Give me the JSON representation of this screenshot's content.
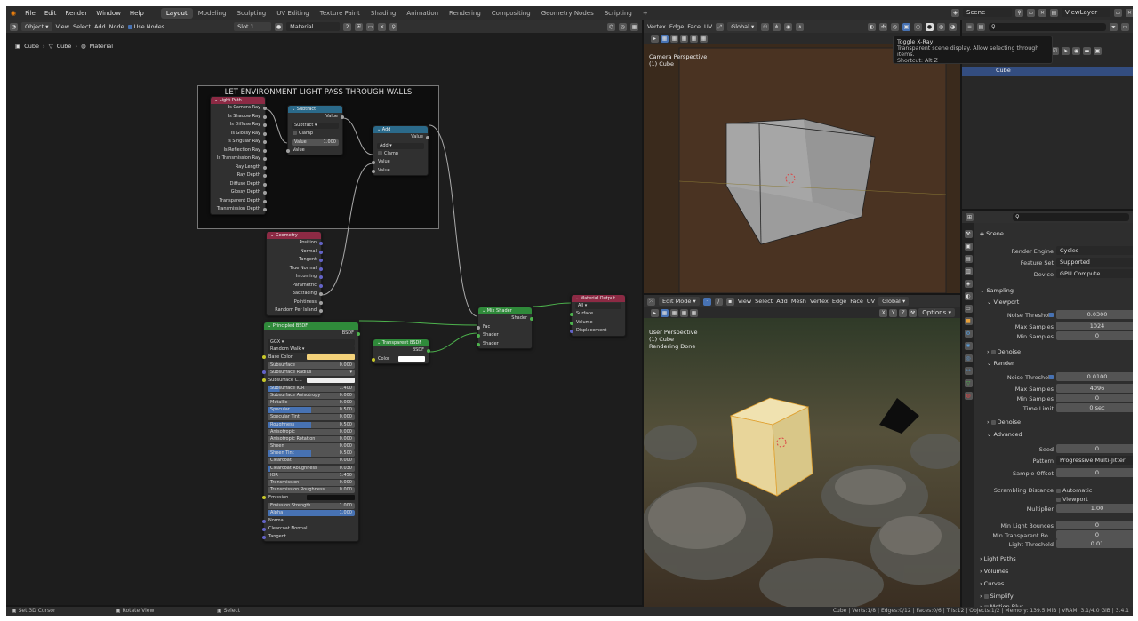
{
  "menu": [
    "File",
    "Edit",
    "Render",
    "Window",
    "Help"
  ],
  "workspaces": [
    "Layout",
    "Modeling",
    "Sculpting",
    "UV Editing",
    "Texture Paint",
    "Shading",
    "Animation",
    "Rendering",
    "Compositing",
    "Geometry Nodes",
    "Scripting"
  ],
  "active_workspace": "Layout",
  "scene_name": "Scene",
  "view_layer": "ViewLayer",
  "node_editor": {
    "header": {
      "mode": "Object",
      "menus": [
        "View",
        "Select",
        "Add",
        "Node"
      ],
      "use_nodes": "Use Nodes",
      "slot": "Slot 1",
      "material": "Material",
      "material_users": "2"
    },
    "breadcrumb": [
      "Cube",
      "Cube",
      "Material"
    ],
    "frame_label": "LET ENVIRONMENT LIGHT PASS THROUGH WALLS",
    "light_path": {
      "title": "Light Path",
      "outputs": [
        "Is Camera Ray",
        "Is Shadow Ray",
        "Is Diffuse Ray",
        "Is Glossy Ray",
        "Is Singular Ray",
        "Is Reflection Ray",
        "Is Transmission Ray",
        "Ray Length",
        "Ray Depth",
        "Diffuse Depth",
        "Glossy Depth",
        "Transparent Depth",
        "Transmission Depth"
      ]
    },
    "subtract": {
      "title": "Subtract",
      "out": "Value",
      "op": "Subtract",
      "clamp": "Clamp",
      "value_label": "Value",
      "value": "1.000",
      "in": "Value"
    },
    "add": {
      "title": "Add",
      "out": "Value",
      "op": "Add",
      "clamp": "Clamp",
      "in1": "Value",
      "in2": "Value"
    },
    "geometry": {
      "title": "Geometry",
      "outputs": [
        "Position",
        "Normal",
        "Tangent",
        "True Normal",
        "Incoming",
        "Parametric",
        "Backfacing",
        "Pointiness",
        "Random Per Island"
      ]
    },
    "bsdf": {
      "title": "Principled BSDF",
      "out": "BSDF",
      "dist": "GGX",
      "sss": "Random Walk",
      "fields": [
        {
          "label": "Base Color",
          "value": "",
          "kind": "color",
          "color": "#f4d27a"
        },
        {
          "label": "Subsurface",
          "value": "0.000",
          "fill": "0%"
        },
        {
          "label": "Subsurface Radius",
          "value": "",
          "kind": "dd"
        },
        {
          "label": "Subsurface C...",
          "value": "",
          "kind": "color",
          "color": "#eeeeee"
        },
        {
          "label": "Subsurface IOR",
          "value": "1.400",
          "fill": "14%"
        },
        {
          "label": "Subsurface Anisotropy",
          "value": "0.000",
          "fill": "0%"
        },
        {
          "label": "Metallic",
          "value": "0.000",
          "fill": "0%"
        },
        {
          "label": "Specular",
          "value": "0.500",
          "fill": "50%"
        },
        {
          "label": "Specular Tint",
          "value": "0.000",
          "fill": "0%"
        },
        {
          "label": "Roughness",
          "value": "0.500",
          "fill": "50%"
        },
        {
          "label": "Anisotropic",
          "value": "0.000",
          "fill": "0%"
        },
        {
          "label": "Anisotropic Rotation",
          "value": "0.000",
          "fill": "0%"
        },
        {
          "label": "Sheen",
          "value": "0.000",
          "fill": "0%"
        },
        {
          "label": "Sheen Tint",
          "value": "0.500",
          "fill": "50%"
        },
        {
          "label": "Clearcoat",
          "value": "0.000",
          "fill": "0%"
        },
        {
          "label": "Clearcoat Roughness",
          "value": "0.030",
          "fill": "3%"
        },
        {
          "label": "IOR",
          "value": "1.450",
          "fill": "0%"
        },
        {
          "label": "Transmission",
          "value": "0.000",
          "fill": "0%"
        },
        {
          "label": "Transmission Roughness",
          "value": "0.000",
          "fill": "0%"
        },
        {
          "label": "Emission",
          "value": "",
          "kind": "color",
          "color": "#111111"
        },
        {
          "label": "Emission Strength",
          "value": "1.000",
          "fill": "0%"
        },
        {
          "label": "Alpha",
          "value": "1.000",
          "fill": "100%"
        }
      ],
      "inputs": [
        "Normal",
        "Clearcoat Normal",
        "Tangent"
      ]
    },
    "transparent": {
      "title": "Transparent BSDF",
      "out": "BSDF",
      "color_label": "Color"
    },
    "mix": {
      "title": "Mix Shader",
      "out": "Shader",
      "in": [
        "Fac",
        "Shader",
        "Shader"
      ]
    },
    "output": {
      "title": "Material Output",
      "target": "All",
      "in": [
        "Surface",
        "Volume",
        "Displacement"
      ]
    }
  },
  "tooltip": {
    "title": "Toggle X-Ray",
    "desc": "Transparent scene display. Allow selecting through items.",
    "shortcut": "Shortcut: Alt Z"
  },
  "top_view": {
    "menus": [
      "Vertex",
      "Edge",
      "Face",
      "UV"
    ],
    "transform": "Global",
    "label": "Camera Perspective",
    "object": "(1) Cube"
  },
  "bottom_view": {
    "mode": "Edit Mode",
    "menus": [
      "View",
      "Select",
      "Add",
      "Mesh",
      "Vertex",
      "Edge",
      "Face",
      "UV"
    ],
    "transform": "Global",
    "options": "Options",
    "label": "User Perspective",
    "object": "(1) Cube",
    "status": "Rendering Done",
    "axes": [
      "X",
      "Y",
      "Z"
    ]
  },
  "outliner": {
    "item": "Cube"
  },
  "properties": {
    "scene": "Scene",
    "render_engine_label": "Render Engine",
    "render_engine": "Cycles",
    "feature_set_label": "Feature Set",
    "feature_set": "Supported",
    "device_label": "Device",
    "device": "GPU Compute",
    "sampling": "Sampling",
    "viewport": "Viewport",
    "vp_noise_label": "Noise Threshold",
    "vp_noise": "0.0300",
    "vp_max_label": "Max Samples",
    "vp_max": "1024",
    "vp_min_label": "Min Samples",
    "vp_min": "0",
    "denoise": "Denoise",
    "render": "Render",
    "r_noise_label": "Noise Threshold",
    "r_noise": "0.0100",
    "r_max_label": "Max Samples",
    "r_max": "4096",
    "r_min_label": "Min Samples",
    "r_min": "0",
    "time_label": "Time Limit",
    "time": "0 sec",
    "denoise2": "Denoise",
    "advanced": "Advanced",
    "seed_label": "Seed",
    "seed": "0",
    "pattern_label": "Pattern",
    "pattern": "Progressive Multi-Jitter",
    "offset_label": "Sample Offset",
    "offset": "0",
    "scramble_label": "Scrambling Distance",
    "automatic": "Automatic",
    "viewport2": "Viewport",
    "mult_label": "Multiplier",
    "mult": "1.00",
    "mlb_label": "Min Light Bounces",
    "mlb": "0",
    "mtb_label": "Min Transparent Bo...",
    "mtb": "0",
    "lt_label": "Light Threshold",
    "lt": "0.01",
    "light_paths": "Light Paths",
    "volumes": "Volumes",
    "curves": "Curves",
    "simplify": "Simplify",
    "motion_blur": "Motion Blur"
  },
  "status": {
    "left1": "Set 3D Cursor",
    "left2": "Rotate View",
    "left3": "Select",
    "right": "Cube | Verts:1/8 | Edges:0/12 | Faces:0/6 | Tris:12 | Objects:1/2 | Memory: 139.5 MiB | VRAM: 3.1/4.0 GiB | 3.4.1"
  }
}
